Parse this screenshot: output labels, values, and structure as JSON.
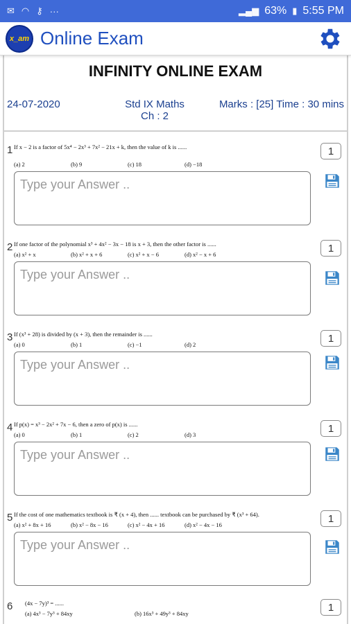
{
  "statusbar": {
    "battery": "63%",
    "time": "5:55 PM",
    "dots": "···"
  },
  "app": {
    "title": "Online Exam",
    "logo_text": "x_am"
  },
  "exam": {
    "title": "INFINITY ONLINE EXAM",
    "date": "24-07-2020",
    "subject": "Std IX Maths",
    "chapter": "Ch : 2",
    "marks_time": "Marks : [25] Time : 30 mins"
  },
  "answer_placeholder": "Type your Answer ..",
  "questions": [
    {
      "num": "1",
      "marks": "1",
      "text": "If  x − 2 is a factor of 5x⁴ − 2x³ + 7x² − 21x + k, then the value of k is ......",
      "options": [
        "(a) 2",
        "(b) 9",
        "(c) 18",
        "(d) −18"
      ]
    },
    {
      "num": "2",
      "marks": "1",
      "text": "If one factor of the polynomial x³ + 4x² − 3x − 18 is x + 3, then the other factor is ......",
      "options": [
        "(a) x² + x",
        "(b) x² + x + 6",
        "(c) x² + x − 6",
        "(d) x² − x + 6"
      ]
    },
    {
      "num": "3",
      "marks": "1",
      "text": "If (x³ + 28) is divided by (x + 3), then the remainder is ......",
      "options": [
        "(a) 0",
        "(b) 1",
        "(c) −1",
        "(d) 2"
      ]
    },
    {
      "num": "4",
      "marks": "1",
      "text": "If p(x) = x³ − 2x² + 7x − 6, then a zero of p(x) is ......",
      "options": [
        "(a) 0",
        "(b) 1",
        "(c) 2",
        "(d) 3"
      ]
    },
    {
      "num": "5",
      "marks": "1",
      "text": "If the cost of one mathematics textbook is ₹ (x + 4), then ...... textbook can be purchased by ₹ (x³ + 64).",
      "options": [
        "(a) x² + 8x + 16",
        "(b) x² − 8x − 16",
        "(c) x² − 4x + 16",
        "(d) x² − 4x − 16"
      ]
    },
    {
      "num": "6",
      "marks": "1",
      "text": "(4x − 7y)³ = ......",
      "options": [
        "(a) 4x³ − 7y³ + 84xy",
        "(b) 16x³ + 49y³ + 84xy"
      ]
    }
  ]
}
